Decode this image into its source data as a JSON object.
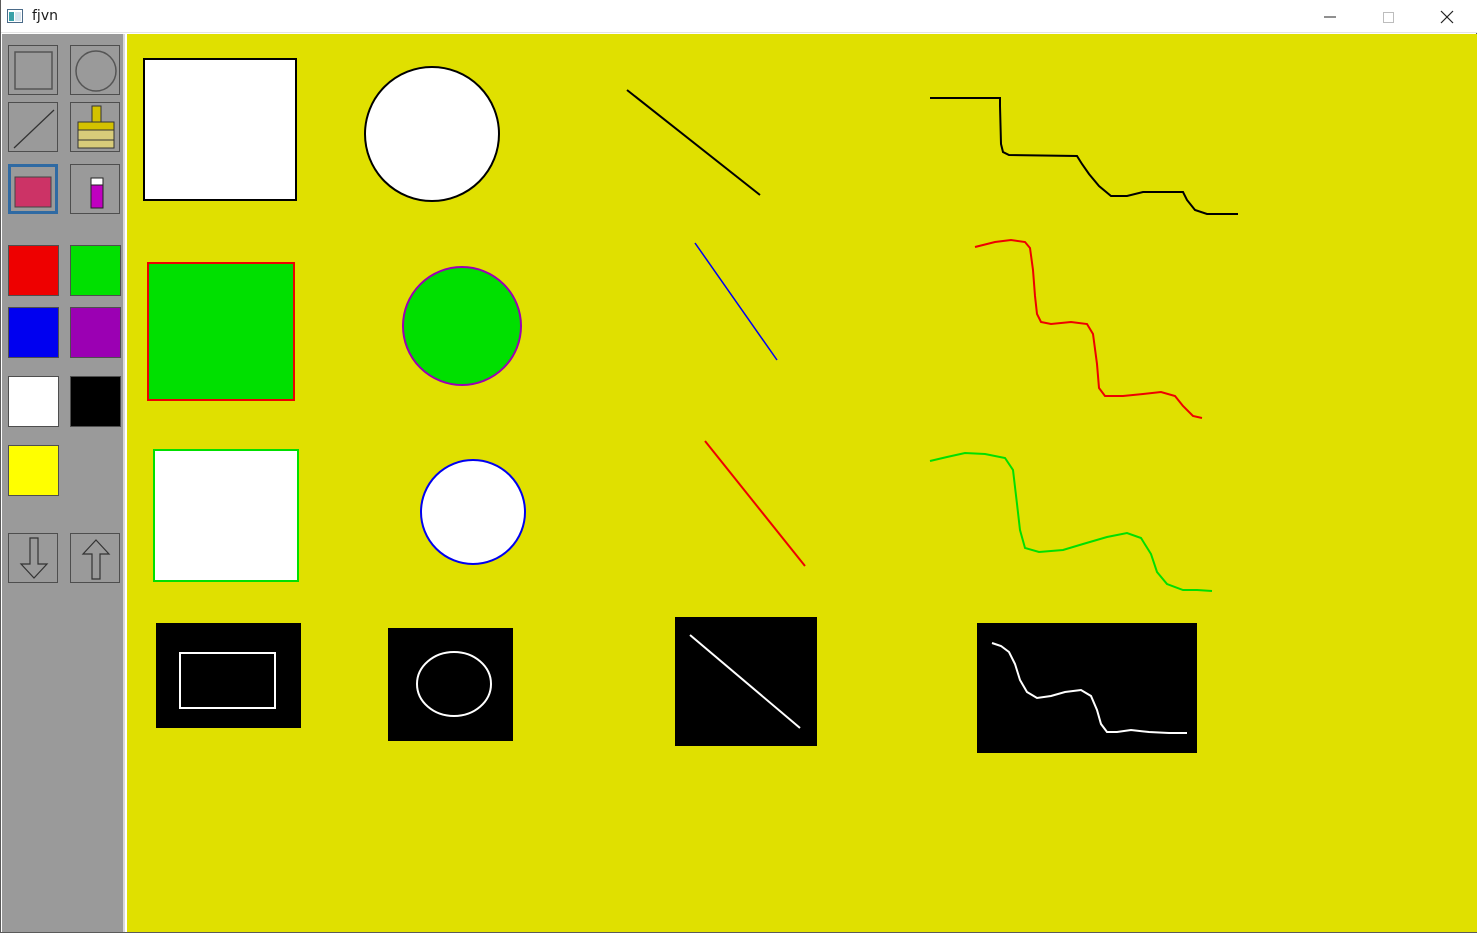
{
  "window": {
    "title": "fjvn",
    "controls": [
      "minimize",
      "maximize",
      "close"
    ]
  },
  "toolbar": {
    "tools": [
      {
        "name": "rectangle-tool",
        "icon": "rectangle-icon",
        "selected": false
      },
      {
        "name": "circle-tool",
        "icon": "circle-icon",
        "selected": false
      },
      {
        "name": "line-tool",
        "icon": "line-icon",
        "selected": false
      },
      {
        "name": "brush-tool",
        "icon": "brush-icon",
        "selected": false
      },
      {
        "name": "fill-color-tool",
        "icon": "fill-swatch-icon",
        "selected": true
      },
      {
        "name": "pen-color-tool",
        "icon": "marker-icon",
        "selected": false
      }
    ],
    "palette": [
      {
        "name": "red",
        "color": "#ee0000"
      },
      {
        "name": "green",
        "color": "#00e000"
      },
      {
        "name": "blue",
        "color": "#0000f0"
      },
      {
        "name": "purple",
        "color": "#9b00b3"
      },
      {
        "name": "white",
        "color": "#ffffff"
      },
      {
        "name": "black",
        "color": "#000000"
      },
      {
        "name": "yellow",
        "color": "#ffff00"
      }
    ],
    "actions": [
      {
        "name": "down-arrow-button",
        "icon": "arrow-down-icon"
      },
      {
        "name": "up-arrow-button",
        "icon": "arrow-up-icon"
      }
    ],
    "selected_fill_color": "#cc3366"
  },
  "canvas": {
    "background": "#e0e000",
    "rows": [
      {
        "stroke": "#000000",
        "fill": "#ffffff",
        "items": [
          "rectangle",
          "circle",
          "line",
          "freehand"
        ]
      },
      {
        "stroke": "#ee0000",
        "fill": "#00e000",
        "items": [
          "rectangle",
          "circle",
          "line",
          "freehand"
        ]
      },
      {
        "stroke": "#00e000",
        "fill": "#ffffff",
        "items": [
          "rectangle",
          "circle",
          "line",
          "freehand"
        ]
      },
      {
        "stroke": "#ffffff",
        "fill": "#000000",
        "items": [
          "rectangle",
          "circle",
          "line",
          "freehand"
        ]
      }
    ]
  }
}
